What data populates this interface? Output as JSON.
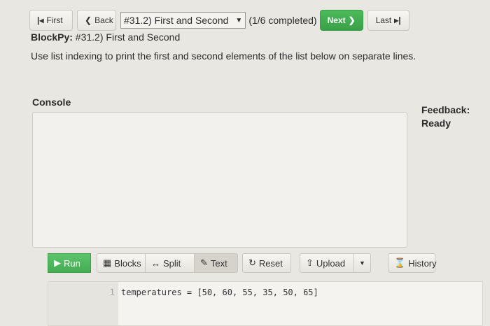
{
  "nav": {
    "first_label": "First",
    "back_label": "Back",
    "assignment_select": "#31.2) First and Second",
    "progress": "(1/6 completed)",
    "next_label": "Next",
    "last_label": "Last"
  },
  "header": {
    "lead": "BlockPy:",
    "title": " #31.2) First and Second",
    "subtitle": "First and Second"
  },
  "instructions": "Use list indexing to print the first and second elements of the list below on separate lines.",
  "console": {
    "label": "Console"
  },
  "feedback": {
    "label": "Feedback:",
    "status": "Ready"
  },
  "toolbar": {
    "run": "Run",
    "blocks": "Blocks",
    "split": "Split",
    "text": "Text",
    "reset": "Reset",
    "upload": "Upload",
    "history": "History"
  },
  "editor": {
    "line_number": "1",
    "code": "temperatures = [50, 60, 55, 35, 50, 65]"
  },
  "colors": {
    "accent_green": "#3aa048",
    "selected_tab": "#d6d3cc"
  }
}
